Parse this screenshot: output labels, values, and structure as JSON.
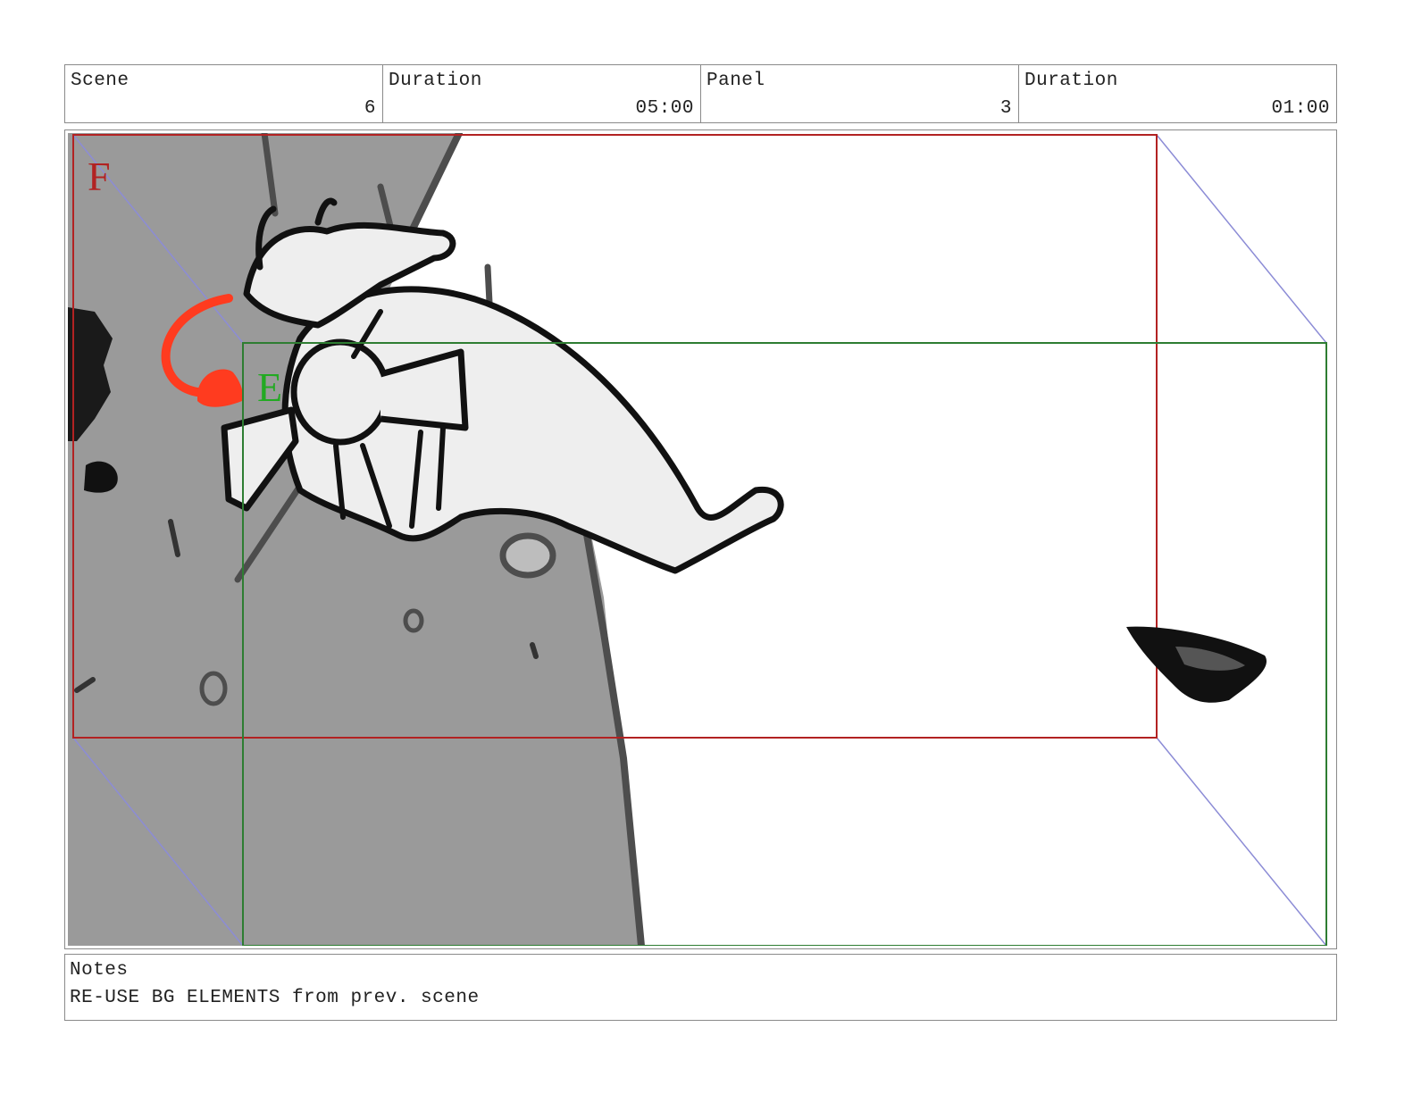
{
  "header": {
    "scene_label": "Scene",
    "scene_value": "6",
    "scene_duration_label": "Duration",
    "scene_duration_value": "05:00",
    "panel_label": "Panel",
    "panel_value": "3",
    "panel_duration_label": "Duration",
    "panel_duration_value": "01:00"
  },
  "frame": {
    "outer_field_letter": "F",
    "inner_field_letter": "E",
    "colors": {
      "background_gray": "#9a9a9a",
      "outer_field": "#b22222",
      "inner_field": "#2e7d32",
      "camera_move": "#8c8cd6",
      "accent": "#ff3b1f"
    }
  },
  "notes": {
    "label": "Notes",
    "text": "RE-USE BG ELEMENTS from prev. scene"
  }
}
